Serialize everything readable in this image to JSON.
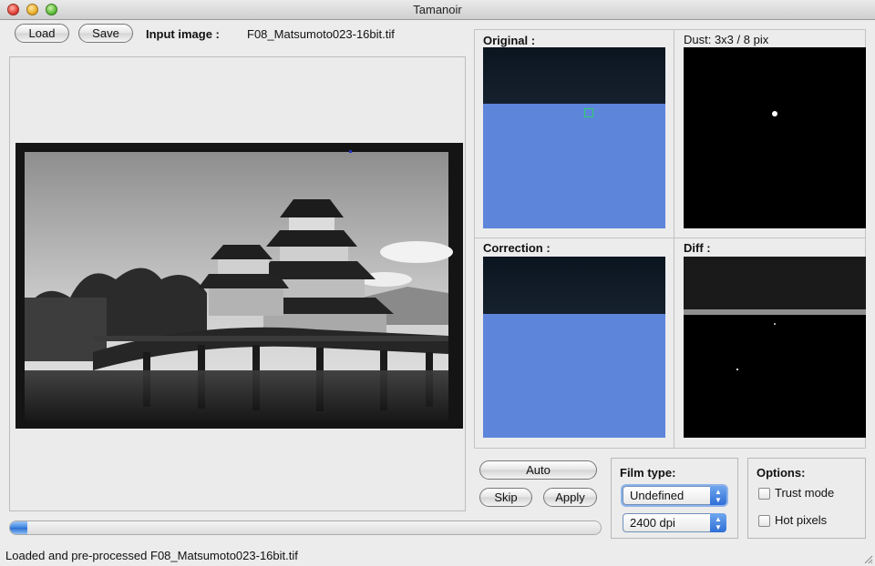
{
  "window": {
    "title": "Tamanoir"
  },
  "toolbar": {
    "load_label": "Load",
    "save_label": "Save",
    "input_image_label": "Input image :",
    "input_image_value": "F08_Matsumoto023-16bit.tif"
  },
  "panels": {
    "original_label": "Original :",
    "dust_label": "Dust: 3x3 / 8 pix",
    "correction_label": "Correction :",
    "diff_label": "Diff :"
  },
  "actions": {
    "auto_label": "Auto",
    "skip_label": "Skip",
    "apply_label": "Apply"
  },
  "film": {
    "label": "Film type:",
    "type_value": "Undefined",
    "dpi_value": "2400 dpi"
  },
  "options": {
    "label": "Options:",
    "trust_mode_label": "Trust mode",
    "trust_mode_checked": false,
    "hot_pixels_label": "Hot pixels",
    "hot_pixels_checked": false
  },
  "progress": {
    "value": 0.03
  },
  "status": {
    "text": "Loaded and pre-processed F08_Matsumoto023-16bit.tif"
  },
  "colors": {
    "sky_blue": "#5d86db",
    "dark_band": "#101a26",
    "selection_green": "#2fcf6a",
    "progress_blue": "#3b84e0"
  }
}
